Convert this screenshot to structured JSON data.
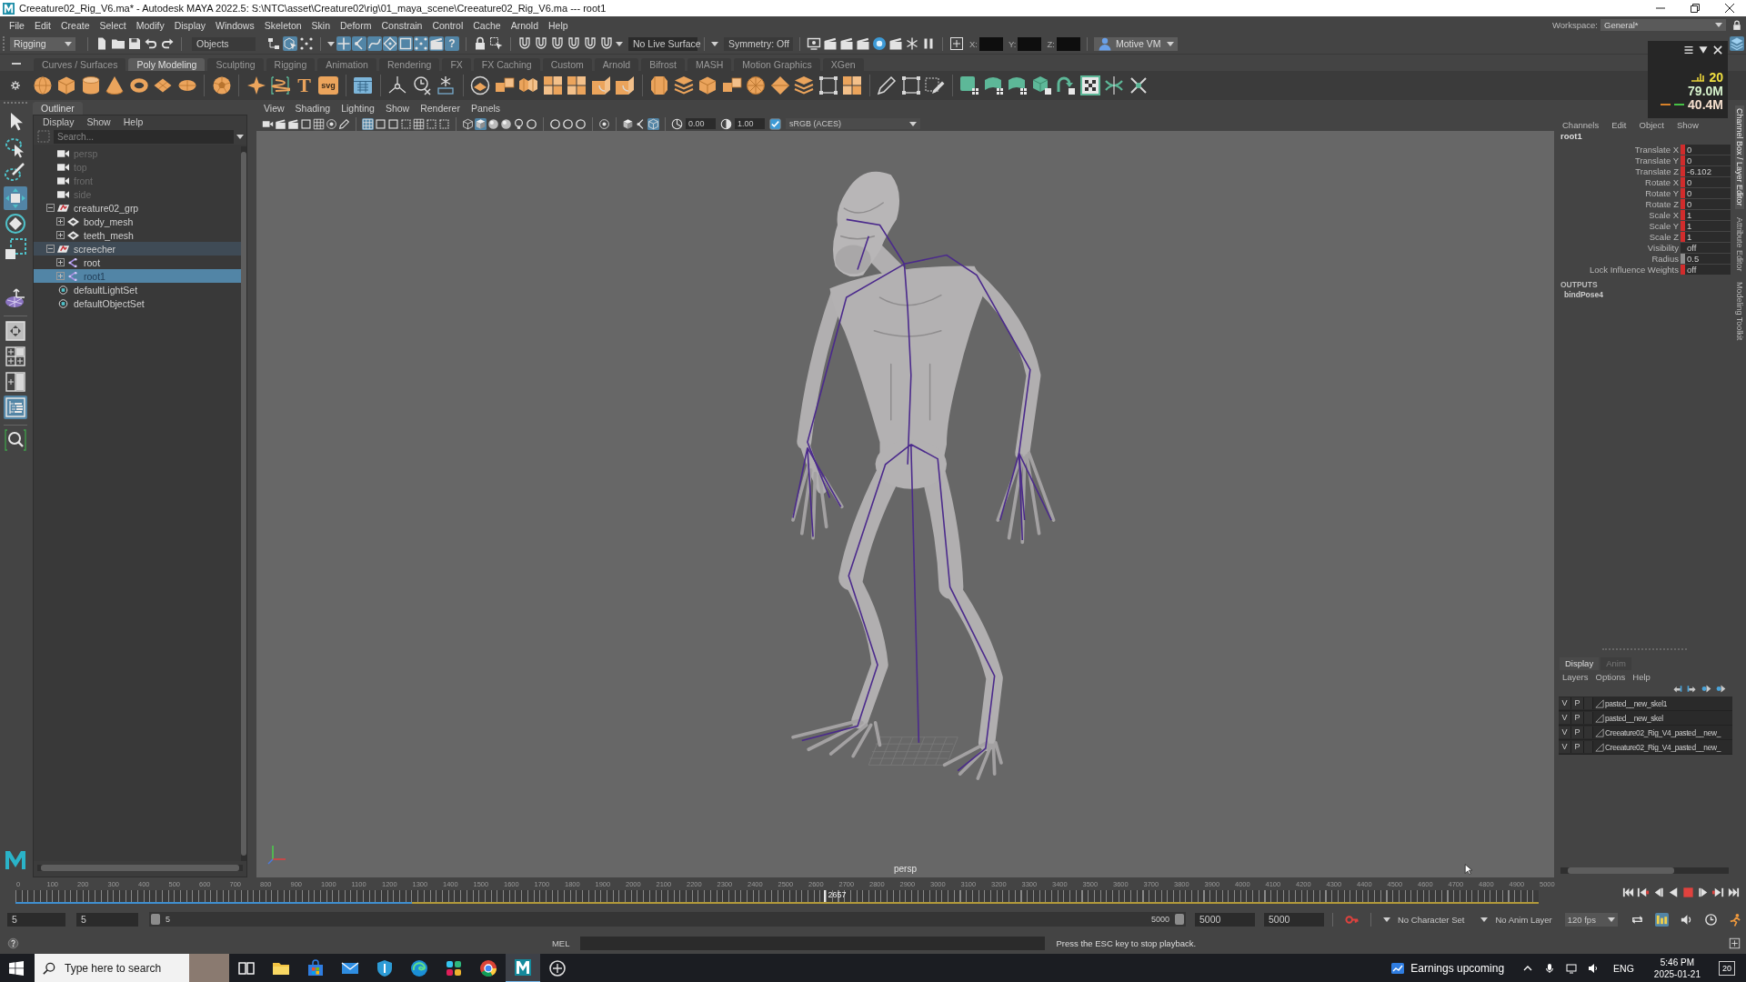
{
  "window": {
    "title": "Creeature02_Rig_V6.ma* - Autodesk MAYA 2022.5: S:\\NTC\\asset\\Creature02\\rig\\01_maya_scene\\Creeature02_Rig_V6.ma --- root1"
  },
  "menu_bar": {
    "items": [
      "File",
      "Edit",
      "Create",
      "Select",
      "Modify",
      "Display",
      "Windows",
      "Skeleton",
      "Skin",
      "Deform",
      "Constrain",
      "Control",
      "Cache",
      "Arnold",
      "Help"
    ],
    "workspace_label": "Workspace:",
    "workspace": "General*"
  },
  "status_line": {
    "menu_set": "Rigging",
    "selection_mode": "Objects",
    "selection_types": [
      {
        "kind": "hierarchy",
        "on": false
      },
      {
        "kind": "object",
        "on": true
      },
      {
        "kind": "component",
        "on": false
      }
    ],
    "selection_masks": [
      {
        "kind": "handle",
        "on": true
      },
      {
        "kind": "joint",
        "on": true
      },
      {
        "kind": "curve",
        "on": true
      },
      {
        "kind": "surface",
        "on": true
      },
      {
        "kind": "deformer",
        "on": true
      },
      {
        "kind": "dynamic",
        "on": true
      },
      {
        "kind": "render",
        "on": true
      },
      {
        "kind": "misc",
        "on": true,
        "glyph": "?"
      }
    ],
    "live_surface": "No Live Surface",
    "symmetry": "Symmetry: Off",
    "coordinate_labels": [
      "X:",
      "Y:",
      "Z:"
    ],
    "camera_device": "Motive VM"
  },
  "shelf": {
    "tabs": [
      {
        "label": "Curves / Surfaces",
        "selected": false
      },
      {
        "label": "Poly Modeling",
        "selected": true
      },
      {
        "label": "Sculpting",
        "selected": false
      },
      {
        "label": "Rigging",
        "selected": false
      },
      {
        "label": "Animation",
        "selected": false
      },
      {
        "label": "Rendering",
        "selected": false
      },
      {
        "label": "FX",
        "selected": false
      },
      {
        "label": "FX Caching",
        "selected": false
      },
      {
        "label": "Custom",
        "selected": false
      },
      {
        "label": "Arnold",
        "selected": false
      },
      {
        "label": "Bifrost",
        "selected": false
      },
      {
        "label": "MASH",
        "selected": false
      },
      {
        "label": "Motion Graphics",
        "selected": false
      },
      {
        "label": "XGen",
        "selected": false
      }
    ],
    "text_tools": [
      "T",
      "svg"
    ]
  },
  "hud": {
    "readouts": [
      "20",
      "79.0M",
      "40.4M"
    ]
  },
  "toolbox": {
    "tools": [
      {
        "kind": "select",
        "selected": false
      },
      {
        "kind": "lasso",
        "selected": false
      },
      {
        "kind": "paint",
        "selected": false
      },
      {
        "kind": "move",
        "selected": true
      },
      {
        "kind": "rotate",
        "selected": false
      },
      {
        "kind": "scale",
        "selected": false
      },
      {
        "kind": "soft",
        "selected": false
      }
    ],
    "layouts": [
      {
        "kind": "single",
        "selected": false
      },
      {
        "kind": "four",
        "selected": false
      },
      {
        "kind": "split",
        "selected": false
      },
      {
        "kind": "outliner",
        "selected": true
      }
    ]
  },
  "outliner": {
    "title": "Outliner",
    "menus": [
      "Display",
      "Show",
      "Help"
    ],
    "search_placeholder": "Search...",
    "items": [
      {
        "name": "persp",
        "kind": "camera",
        "dimmed": true,
        "selected": false,
        "highlighted": false
      },
      {
        "name": "top",
        "kind": "camera",
        "dimmed": true,
        "selected": false,
        "highlighted": false
      },
      {
        "name": "front",
        "kind": "camera",
        "dimmed": true,
        "selected": false,
        "highlighted": false
      },
      {
        "name": "side",
        "kind": "camera",
        "dimmed": true,
        "selected": false,
        "highlighted": false
      },
      {
        "name": "creature02_grp",
        "kind": "group",
        "dimmed": false,
        "selected": false,
        "highlighted": false,
        "expanded": true,
        "children": [
          {
            "name": "body_mesh",
            "kind": "mesh",
            "dimmed": false,
            "selected": false,
            "highlighted": false,
            "expanded": false
          },
          {
            "name": "teeth_mesh",
            "kind": "mesh",
            "dimmed": false,
            "selected": false,
            "highlighted": false,
            "expanded": false
          }
        ]
      },
      {
        "name": "screecher",
        "kind": "group",
        "dimmed": false,
        "selected": false,
        "highlighted": true,
        "expanded": true,
        "children": [
          {
            "name": "root",
            "kind": "joint",
            "dimmed": false,
            "selected": false,
            "highlighted": false,
            "expanded": false
          },
          {
            "name": "root1",
            "kind": "joint",
            "dimmed": false,
            "selected": true,
            "highlighted": false,
            "expanded": false
          }
        ]
      },
      {
        "name": "defaultLightSet",
        "kind": "set",
        "dimmed": false,
        "selected": false,
        "highlighted": false
      },
      {
        "name": "defaultObjectSet",
        "kind": "set",
        "dimmed": false,
        "selected": false,
        "highlighted": false
      }
    ]
  },
  "viewport": {
    "menus": [
      "View",
      "Shading",
      "Lighting",
      "Show",
      "Renderer",
      "Panels"
    ],
    "toolbar": [
      {
        "kind": "camera",
        "on": false
      },
      {
        "kind": "camera_attr",
        "on": false
      },
      {
        "kind": "bookmark",
        "on": false
      },
      {
        "kind": "image_plane",
        "on": false
      },
      {
        "kind": "grid_2d",
        "on": false
      },
      {
        "kind": "pan_zoom",
        "on": false
      },
      {
        "kind": "grease_pencil",
        "on": false
      },
      {
        "kind": "grid",
        "on": true
      },
      {
        "kind": "film_gate",
        "on": false
      },
      {
        "kind": "resolution_gate",
        "on": false
      },
      {
        "kind": "gate_mask",
        "on": false
      },
      {
        "kind": "field_chart",
        "on": false
      },
      {
        "kind": "safe_action",
        "on": false
      },
      {
        "kind": "safe_title",
        "on": false
      },
      {
        "kind": "wireframe",
        "on": false
      },
      {
        "kind": "smooth_shade",
        "on": true
      },
      {
        "kind": "default_material",
        "on": false
      },
      {
        "kind": "textured",
        "on": false
      },
      {
        "kind": "lights",
        "on": false
      },
      {
        "kind": "shadows",
        "on": false
      },
      {
        "kind": "ssao",
        "on": false
      },
      {
        "kind": "motion_blur",
        "on": false
      },
      {
        "kind": "aa",
        "on": false
      },
      {
        "kind": "isolate",
        "on": false
      },
      {
        "kind": "xray",
        "on": false
      },
      {
        "kind": "xray_joints",
        "on": false
      },
      {
        "kind": "xray_components",
        "on": true
      }
    ],
    "exposure": "0.00",
    "gamma": "1.00",
    "color_managed": true,
    "color_space": "sRGB (ACES)",
    "camera": "persp"
  },
  "channel_box": {
    "menus": [
      "Channels",
      "Edit",
      "Object",
      "Show"
    ],
    "object": "root1",
    "channels": [
      {
        "name": "Translate X",
        "value": "0",
        "keyed": true,
        "locked": false
      },
      {
        "name": "Translate Y",
        "value": "0",
        "keyed": true,
        "locked": false
      },
      {
        "name": "Translate Z",
        "value": "-6.102",
        "keyed": true,
        "locked": false
      },
      {
        "name": "Rotate X",
        "value": "0",
        "keyed": true,
        "locked": false
      },
      {
        "name": "Rotate Y",
        "value": "0",
        "keyed": true,
        "locked": false
      },
      {
        "name": "Rotate Z",
        "value": "0",
        "keyed": true,
        "locked": false
      },
      {
        "name": "Scale X",
        "value": "1",
        "keyed": true,
        "locked": false
      },
      {
        "name": "Scale Y",
        "value": "1",
        "keyed": true,
        "locked": false
      },
      {
        "name": "Scale Z",
        "value": "1",
        "keyed": true,
        "locked": false
      },
      {
        "name": "Visibility",
        "value": "off",
        "keyed": false,
        "locked": false
      },
      {
        "name": "Radius",
        "value": "0.5",
        "keyed": false,
        "locked": true
      },
      {
        "name": "Lock Influence Weights",
        "value": "off",
        "keyed": true,
        "locked": false
      }
    ],
    "outputs_heading": "OUTPUTS",
    "outputs": [
      "bindPose4"
    ]
  },
  "side_tabs": [
    {
      "label": "Channel Box / Layer Editor",
      "selected": true
    },
    {
      "label": "Attribute Editor",
      "selected": false
    },
    {
      "label": "Modeling Toolkit",
      "selected": false
    }
  ],
  "layer_editor": {
    "tabs": [
      {
        "label": "Display",
        "selected": true
      },
      {
        "label": "Anim",
        "selected": false
      }
    ],
    "menus": [
      "Layers",
      "Options",
      "Help"
    ],
    "layers": [
      {
        "visibility": "V",
        "playback": "P",
        "name": "pasted__new_skel1"
      },
      {
        "visibility": "V",
        "playback": "P",
        "name": "pasted__new_skel"
      },
      {
        "visibility": "V",
        "playback": "P",
        "name": "Creeature02_Rig_V4_pasted__new_"
      },
      {
        "visibility": "V",
        "playback": "P",
        "name": "Creeature02_Rig_V4_pasted__new_"
      }
    ]
  },
  "timeline": {
    "ticks": [
      "0",
      "100",
      "200",
      "300",
      "400",
      "500",
      "600",
      "700",
      "800",
      "900",
      "1000",
      "1100",
      "1200",
      "1300",
      "1400",
      "1500",
      "1600",
      "1700",
      "1800",
      "1900",
      "2000",
      "2100",
      "2200",
      "2300",
      "2400",
      "2500",
      "2600",
      "2700",
      "2800",
      "2900",
      "3000",
      "3100",
      "3200",
      "3300",
      "3400",
      "3500",
      "3600",
      "3700",
      "3800",
      "3900",
      "4000",
      "4100",
      "4200",
      "4300",
      "4400",
      "4500",
      "4600",
      "4700",
      "4800",
      "4900",
      "5000"
    ],
    "current_frame": {
      "label": "2657",
      "level": 0.531
    },
    "cache": {
      "level": 0.26
    }
  },
  "range_slider": {
    "scene_start": "5",
    "playback_start": "5",
    "range_start": "5",
    "range_end": "5000",
    "playback_end": "5000",
    "scene_end": "5000",
    "auto_key": {
      "on": true
    },
    "character_set": "No Character Set",
    "anim_layer": "No Anim Layer",
    "frame_rate": "120 fps",
    "playback_options": [
      {
        "kind": "loop",
        "on": false
      },
      {
        "kind": "cache",
        "on": true
      },
      {
        "kind": "sound",
        "on": false
      },
      {
        "kind": "settings",
        "on": false
      },
      {
        "kind": "preferences",
        "on": false
      }
    ]
  },
  "command_line": {
    "language": "MEL",
    "help_text": "Press the ESC key to stop playback."
  },
  "taskbar": {
    "search_placeholder": "Type here to search",
    "apps": [
      {
        "kind": "task_view",
        "active": false
      },
      {
        "kind": "explorer",
        "active": false
      },
      {
        "kind": "store",
        "active": false
      },
      {
        "kind": "mail",
        "active": false
      },
      {
        "kind": "shield",
        "active": false
      },
      {
        "kind": "edge",
        "active": false
      },
      {
        "kind": "slack",
        "active": false
      },
      {
        "kind": "chrome",
        "active": false
      },
      {
        "kind": "maya",
        "active": true
      },
      {
        "kind": "circle",
        "active": false
      }
    ],
    "news": "Earnings upcoming",
    "language": "ENG",
    "time": "5:46 PM",
    "date": "2025-01-21",
    "notifications": "20"
  }
}
